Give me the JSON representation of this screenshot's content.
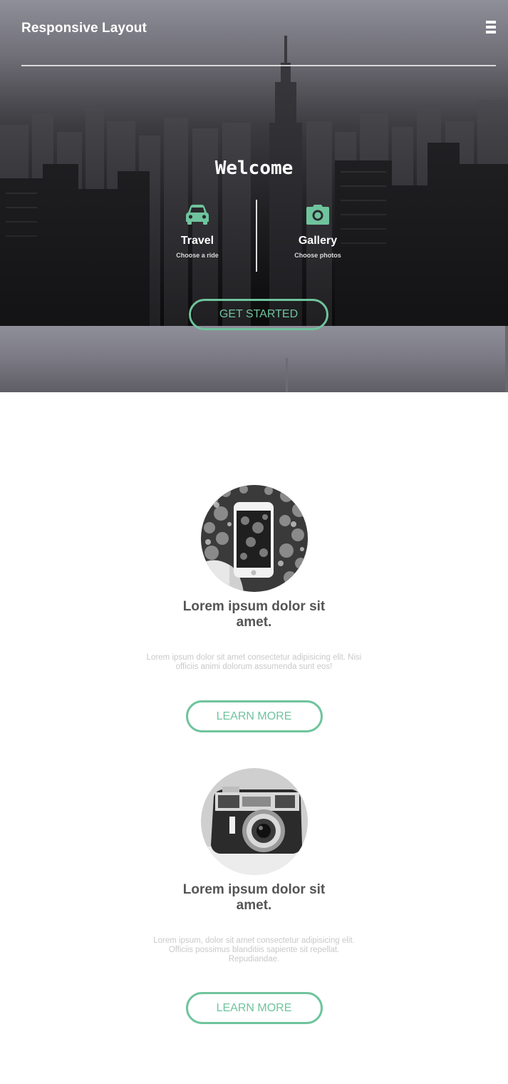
{
  "header": {
    "brand": "Responsive Layout",
    "menu_icon": "hamburger-menu-icon"
  },
  "hero": {
    "welcome": "Welcome",
    "features": [
      {
        "icon": "car-icon",
        "title": "Travel",
        "subtitle": "Choose a ride"
      },
      {
        "icon": "camera-icon",
        "title": "Gallery",
        "subtitle": "Choose photos"
      }
    ],
    "cta_label": "GET STARTED"
  },
  "cards": [
    {
      "image": "smartphone-photo",
      "title": "Lorem ipsum dolor sit amet.",
      "text": "Lorem ipsum dolor sit amet consectetur adipisicing elit. Nisi officiis animi dolorum assumenda sunt eos!",
      "button_label": "LEARN MORE"
    },
    {
      "image": "vintage-camera-photo",
      "title": "Lorem ipsum dolor sit amet.",
      "text": "Lorem ipsum, dolor sit amet consectetur adipisicing elit. Officiis possimus blanditiis sapiente sit repellat. Repudiandae.",
      "button_label": "LEARN MORE"
    }
  ],
  "colors": {
    "accent": "#6fc49d",
    "card_title": "#555555",
    "card_text": "#c9c9c9"
  }
}
